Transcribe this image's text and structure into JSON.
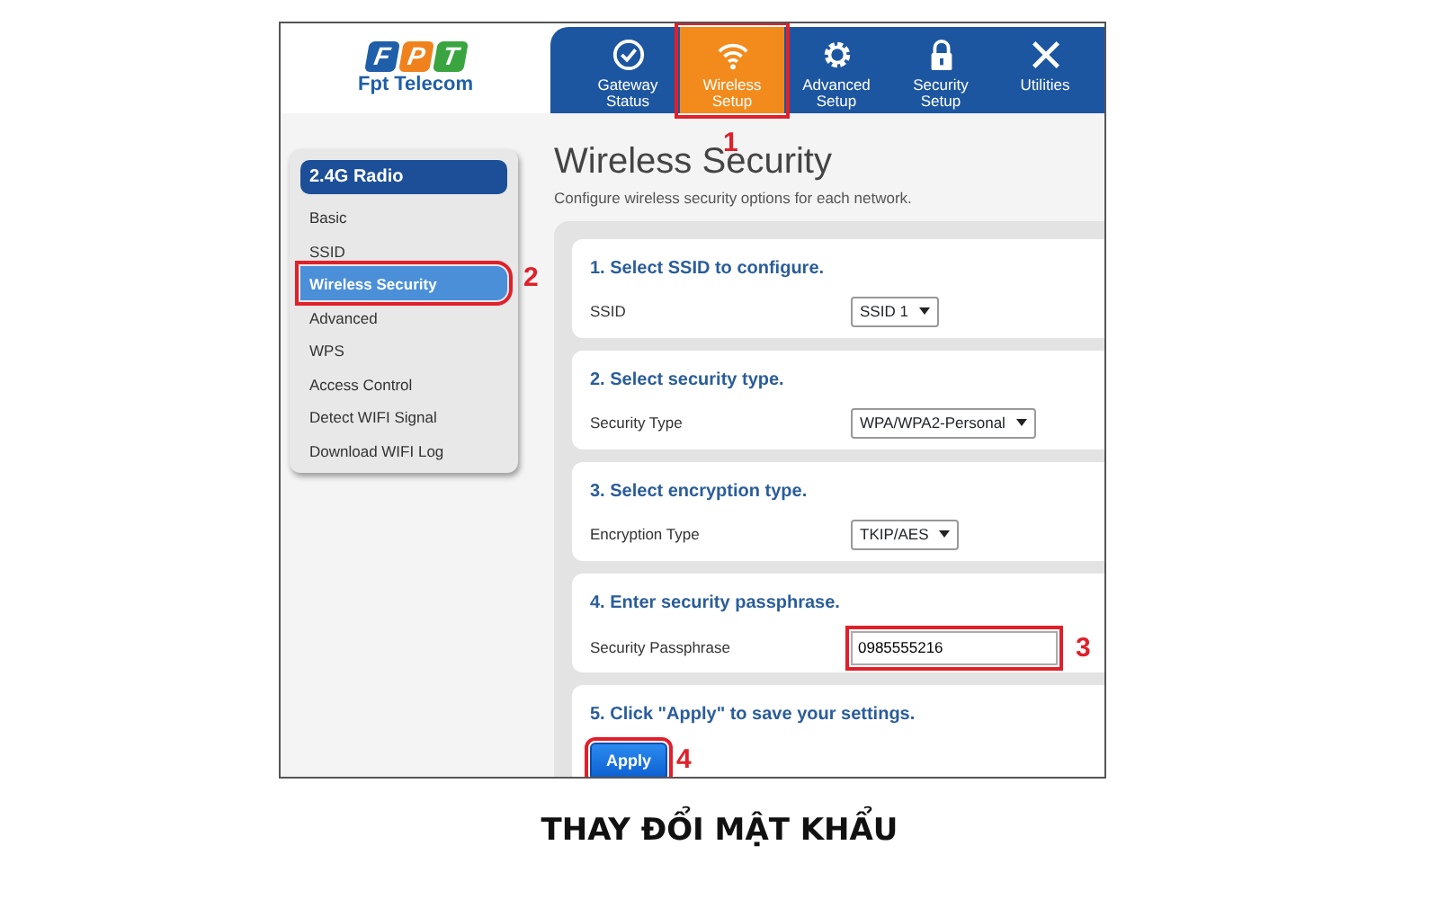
{
  "logo": {
    "tiles": [
      {
        "letter": "F",
        "color": "#1f5ea8"
      },
      {
        "letter": "P",
        "color": "#f0821e"
      },
      {
        "letter": "T",
        "color": "#3aa540"
      }
    ],
    "name": "Fpt Telecom"
  },
  "nav_tabs": [
    {
      "label": "Gateway Status",
      "selected": false
    },
    {
      "label": "Wireless Setup",
      "selected": true,
      "callout": "1"
    },
    {
      "label": "Advanced Setup",
      "selected": false
    },
    {
      "label": "Security Setup",
      "selected": false
    },
    {
      "label": "Utilities",
      "selected": false
    }
  ],
  "sidebar": {
    "heading": "2.4G Radio",
    "items": [
      {
        "label": "Basic",
        "selected": false
      },
      {
        "label": "SSID",
        "selected": false
      },
      {
        "label": "Wireless Security",
        "selected": true,
        "callout": "2"
      },
      {
        "label": "Advanced",
        "selected": false
      },
      {
        "label": "WPS",
        "selected": false
      },
      {
        "label": "Access Control",
        "selected": false
      },
      {
        "label": "Detect WIFI Signal",
        "selected": false
      },
      {
        "label": "Download WIFI Log",
        "selected": false
      }
    ]
  },
  "page": {
    "title": "Wireless Security",
    "subtitle": "Configure wireless security options for each network."
  },
  "sections": [
    {
      "heading": "1. Select SSID to configure.",
      "kind": "select",
      "label": "SSID",
      "value": "SSID 1"
    },
    {
      "heading": "2. Select security type.",
      "kind": "select",
      "label": "Security Type",
      "value": "WPA/WPA2-Personal"
    },
    {
      "heading": "3. Select encryption type.",
      "kind": "select",
      "label": "Encryption Type",
      "value": "TKIP/AES"
    },
    {
      "heading": "4. Enter security passphrase.",
      "kind": "text",
      "label": "Security Passphrase",
      "value": "0985555216",
      "callout": "3"
    },
    {
      "heading": "5. Click \"Apply\" to save your settings.",
      "kind": "button",
      "value": "Apply",
      "callout": "4"
    }
  ],
  "caption": "THAY ĐỔI MẬT KHẨU"
}
